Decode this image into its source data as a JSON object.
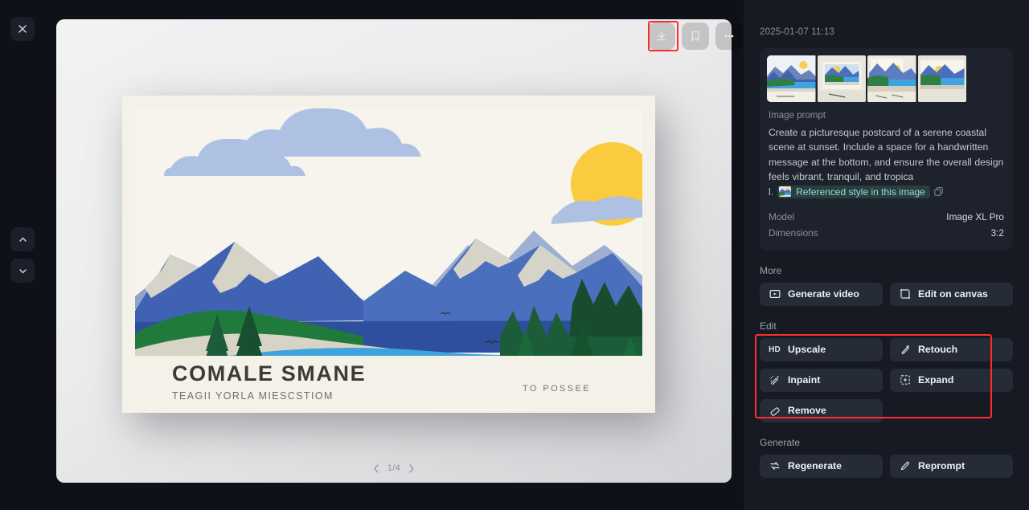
{
  "left_rail": {
    "close_icon": "close-icon",
    "prev_icon": "chevron-up-icon",
    "next_icon": "chevron-down-icon"
  },
  "toolbar": {
    "download_label": "Download",
    "bookmark_label": "Bookmark",
    "more_label": "More options"
  },
  "viewer": {
    "pagination": "1/4",
    "prev_arrow": "chevron-left-icon",
    "next_arrow": "chevron-right-icon",
    "postcard": {
      "headline": "COMALE SMANE",
      "subline": "TEAGII YORLA MIESCSTIOM",
      "corner_text": "TO POSSEE"
    }
  },
  "panel": {
    "timestamp": "2025-01-07 11:13",
    "prompt_label": "Image prompt",
    "prompt_text": "Create a picturesque postcard of a serene coastal scene at sunset. Include a space for a handwritten message at the bottom, and ensure the overall design feels vibrant, tranquil, and tropica",
    "ref_lead": "l.",
    "ref_chip_label": "Referenced style in this image",
    "copy_icon": "copy-icon",
    "meta": [
      {
        "key": "Model",
        "value": "Image XL Pro"
      },
      {
        "key": "Dimensions",
        "value": "3:2"
      }
    ],
    "more": {
      "label": "More",
      "buttons": [
        {
          "label": "Generate video",
          "icon": "video-frame-icon"
        },
        {
          "label": "Edit on canvas",
          "icon": "crop-frame-icon"
        }
      ]
    },
    "edit": {
      "label": "Edit",
      "buttons": [
        {
          "label": "Upscale",
          "icon": "hd-badge-icon"
        },
        {
          "label": "Retouch",
          "icon": "magic-wand-icon"
        },
        {
          "label": "Inpaint",
          "icon": "inpaint-brush-icon"
        },
        {
          "label": "Expand",
          "icon": "expand-frame-icon"
        },
        {
          "label": "Remove",
          "icon": "eraser-icon"
        }
      ]
    },
    "generate": {
      "label": "Generate",
      "buttons": [
        {
          "label": "Regenerate",
          "icon": "refresh-arrows-icon"
        },
        {
          "label": "Reprompt",
          "icon": "pencil-icon"
        }
      ]
    }
  },
  "highlights": {
    "download_button_color": "#ff2d2d",
    "edit_section_color": "#ff2d2d"
  }
}
